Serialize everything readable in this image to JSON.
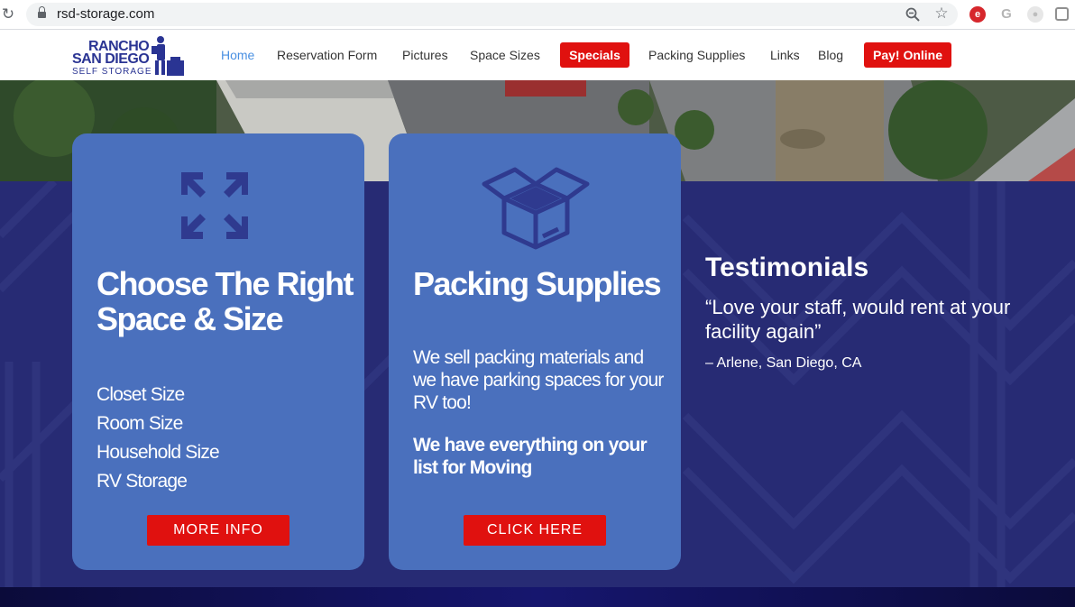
{
  "browser": {
    "url": "rsd-storage.com"
  },
  "logo": {
    "line1": "RANCHO",
    "line2": "SAN DIEGO",
    "line3": "SELF STORAGE"
  },
  "nav": {
    "items": [
      {
        "label": "Home",
        "active": true
      },
      {
        "label": "Reservation Form"
      },
      {
        "label": "Pictures"
      },
      {
        "label": "Space Sizes"
      },
      {
        "label": "Specials",
        "highlight": true
      },
      {
        "label": "Packing Supplies"
      },
      {
        "label": "Links"
      },
      {
        "label": "Blog"
      },
      {
        "label": "Pay! Online",
        "highlight": true
      }
    ]
  },
  "cards": [
    {
      "icon": "expand-arrows-icon",
      "title": "Choose The Right Space & Size",
      "list": [
        "Closet Size",
        "Room Size",
        "Household Size",
        "RV Storage"
      ],
      "button": "MORE INFO"
    },
    {
      "icon": "open-box-icon",
      "title": "Packing Supplies",
      "text": "We sell packing materials and we have parking spaces for your RV too!",
      "text_bold": "We have everything on your list for Moving",
      "button": "CLICK HERE"
    }
  ],
  "testimonials": {
    "title": "Testimonials",
    "quote": "“Love your staff, would rent at your facility again”",
    "author": "– Arlene, San Diego, CA"
  },
  "colors": {
    "brand_blue": "#2a3493",
    "card_blue": "#4a70bd",
    "accent_red": "#e0110f",
    "background_navy": "#272b74",
    "nav_active": "#4a90e2"
  }
}
